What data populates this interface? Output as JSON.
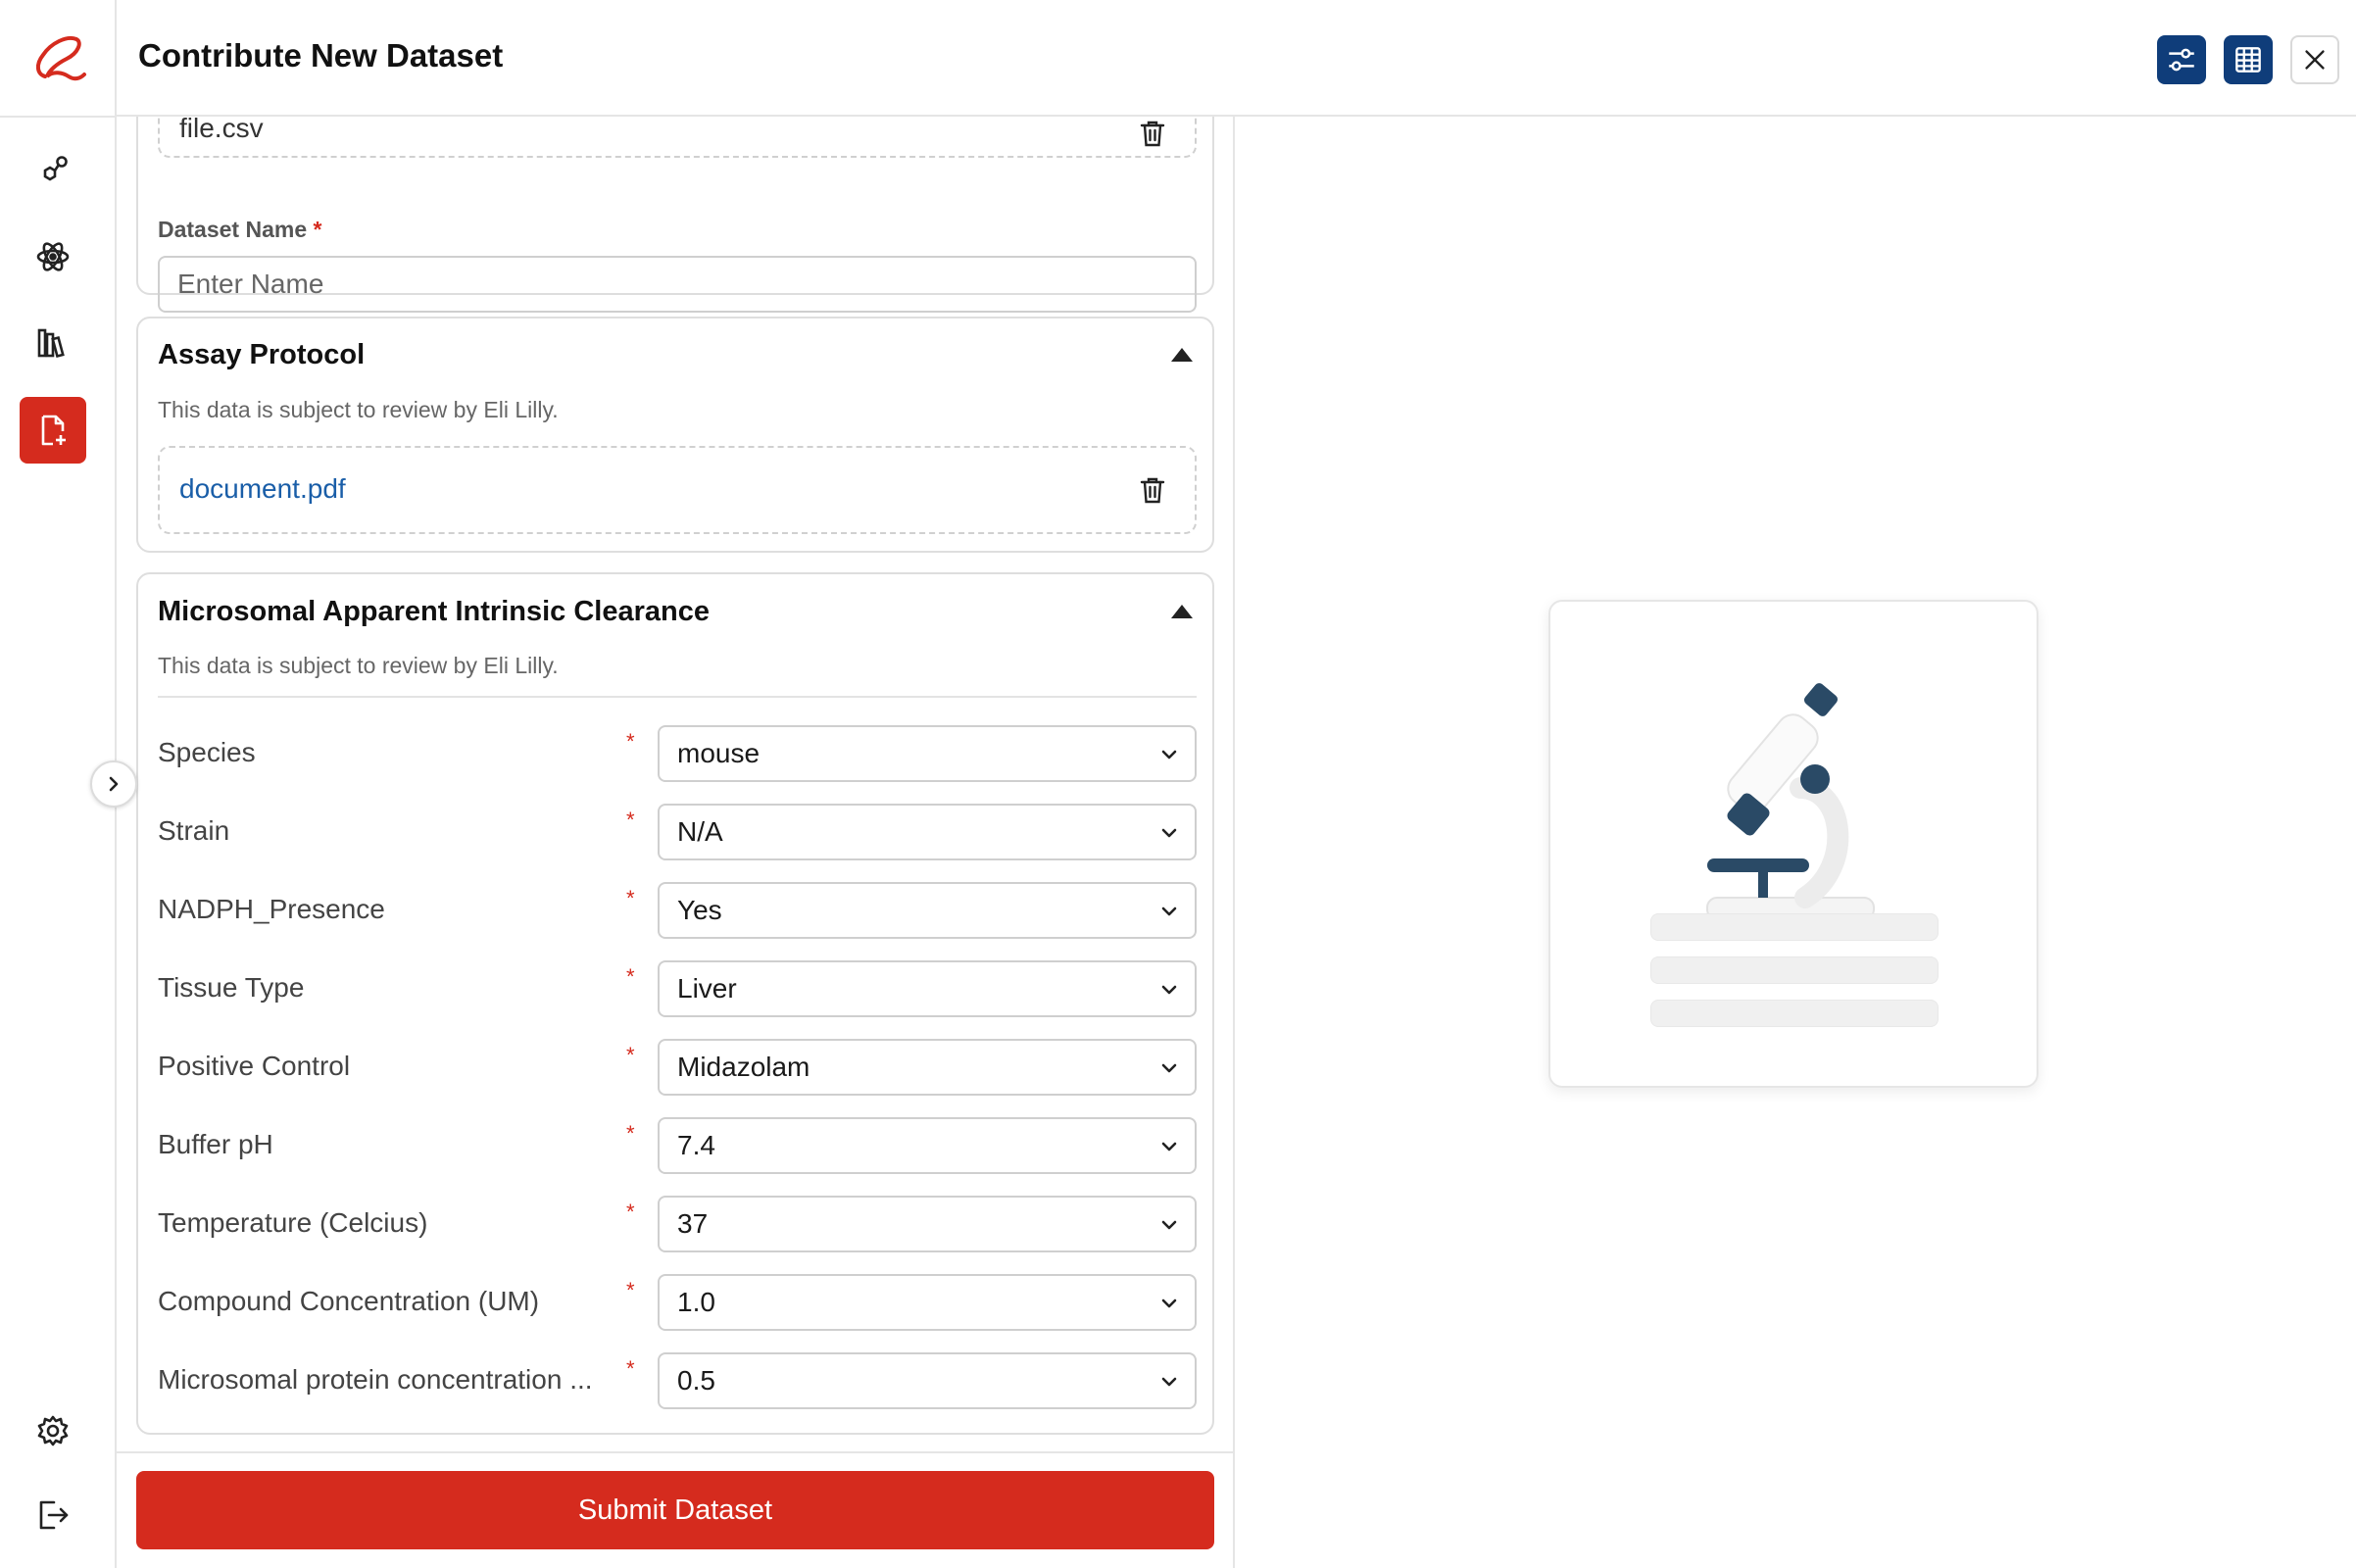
{
  "header": {
    "title": "Contribute New Dataset",
    "filter_icon": "sliders-icon",
    "table_icon": "table-icon",
    "close_icon": "close-icon"
  },
  "sidebar": {
    "items": [
      {
        "name": "molecule-icon"
      },
      {
        "name": "atom-icon"
      },
      {
        "name": "library-icon"
      },
      {
        "name": "add-file-icon",
        "active": true
      }
    ],
    "bottom": [
      {
        "name": "gear-icon"
      },
      {
        "name": "logout-icon"
      }
    ]
  },
  "dataset_file": {
    "file_name": "file.csv",
    "name_label": "Dataset Name",
    "name_placeholder": "Enter Name"
  },
  "assay": {
    "title": "Assay Protocol",
    "subtitle": "This data is subject to review by Eli Lilly.",
    "file_name": "document.pdf"
  },
  "clearance": {
    "title": "Microsomal Apparent Intrinsic Clearance",
    "subtitle": "This data is subject to review by Eli Lilly.",
    "rows": [
      {
        "label": "Species",
        "value": "mouse"
      },
      {
        "label": "Strain",
        "value": "N/A"
      },
      {
        "label": "NADPH_Presence",
        "value": "Yes"
      },
      {
        "label": "Tissue Type",
        "value": "Liver"
      },
      {
        "label": "Positive Control",
        "value": "Midazolam"
      },
      {
        "label": "Buffer pH",
        "value": "7.4"
      },
      {
        "label": "Temperature (Celcius)",
        "value": "37"
      },
      {
        "label": "Compound Concentration (UM)",
        "value": "1.0"
      },
      {
        "label": "Microsomal protein concentration ...",
        "value": "0.5"
      }
    ]
  },
  "required_mark": "*",
  "submit_label": "Submit Dataset",
  "colors": {
    "accent": "#d52b1e",
    "header_buttons": "#0f3d7a",
    "link": "#1a5ea8"
  }
}
